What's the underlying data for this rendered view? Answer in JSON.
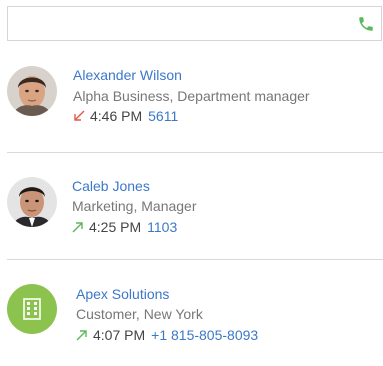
{
  "search": {
    "value": "",
    "placeholder": ""
  },
  "contacts": [
    {
      "name": "Alexander Wilson",
      "subtitle": "Alpha Business, Department manager",
      "time": "4:46 PM",
      "number": "5611",
      "direction": "incoming",
      "avatar": "person-photo"
    },
    {
      "name": "Caleb Jones",
      "subtitle": "Marketing, Manager",
      "time": "4:25 PM",
      "number": "1103",
      "direction": "outgoing",
      "avatar": "person-photo"
    },
    {
      "name": "Apex Solutions",
      "subtitle": "Customer, New York",
      "time": "4:07 PM",
      "number": "+1 815-805-8093",
      "direction": "outgoing",
      "avatar": "company-icon"
    }
  ],
  "colors": {
    "accent": "#3c78c8",
    "incoming_arrow": "#e05a4e",
    "outgoing_arrow": "#5cb85c",
    "company_avatar": "#8cc34f",
    "phone_icon": "#5cb85c"
  }
}
